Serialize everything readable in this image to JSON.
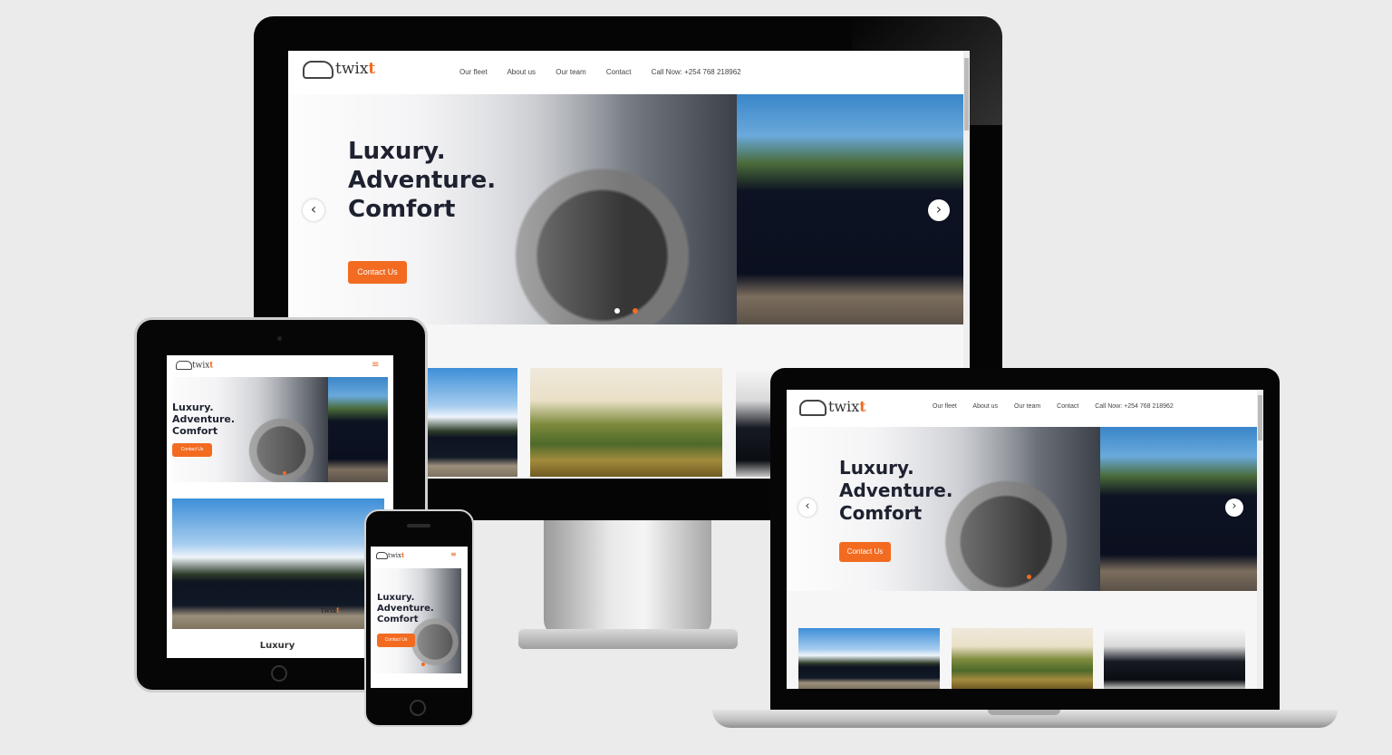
{
  "site": {
    "brand_name": "twix",
    "brand_accent": "t",
    "nav": [
      "Our fleet",
      "About us",
      "Our team",
      "Contact",
      "Call Now: +254 768 218962"
    ],
    "hero": {
      "line1": "Luxury.",
      "line2": "Adventure.",
      "line3": "Comfort",
      "cta": "Contact Us",
      "prev_icon": "‹",
      "next_icon": "›"
    },
    "menu_icon": "≡",
    "tablet_section_title": "Luxury",
    "watermark_brand": "twix",
    "watermark_accent": "t"
  },
  "colors": {
    "accent": "#f26b21",
    "headline": "#1e2230",
    "background": "#ebebeb"
  }
}
